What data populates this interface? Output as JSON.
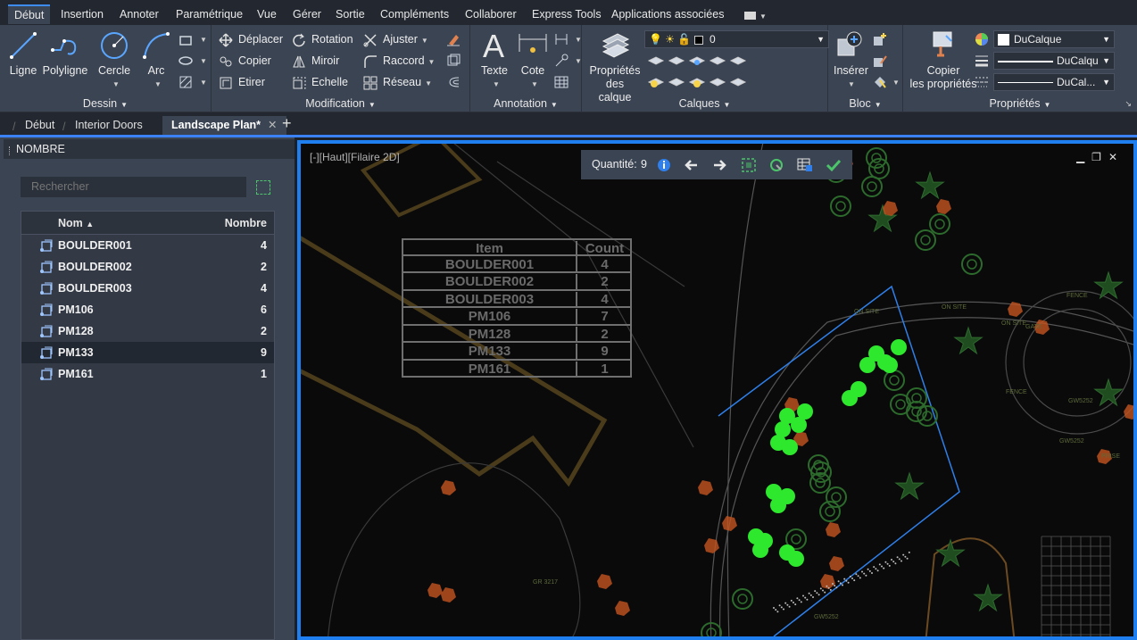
{
  "menu": {
    "tabs": [
      "Début",
      "Insertion",
      "Annoter",
      "Paramétrique",
      "Vue",
      "Gérer",
      "Sortie",
      "Compléments",
      "Collaborer",
      "Express Tools",
      "Applications associées"
    ],
    "active_tab": "Début"
  },
  "ribbon": {
    "dessin": {
      "title": "Dessin",
      "ligne": "Ligne",
      "polyligne": "Polyligne",
      "cercle": "Cercle",
      "arc": "Arc"
    },
    "modification": {
      "title": "Modification",
      "deplacer": "Déplacer",
      "rotation": "Rotation",
      "ajuster": "Ajuster",
      "copier": "Copier",
      "miroir": "Miroir",
      "raccord": "Raccord",
      "etirer": "Etirer",
      "echelle": "Echelle",
      "reseau": "Réseau"
    },
    "annotation": {
      "title": "Annotation",
      "texte": "Texte",
      "cote": "Cote"
    },
    "calques": {
      "title": "Calques",
      "proprietes_line1": "Propriétés",
      "proprietes_line2": "des calque",
      "current_layer": "0"
    },
    "bloc": {
      "title": "Bloc",
      "inserer": "Insérer"
    },
    "proprietes": {
      "title": "Propriétés",
      "copier_line1": "Copier",
      "copier_line2": "les propriétés",
      "color": "DuCalque",
      "linetype": "DuCalqu",
      "lineweight": "DuCal..."
    }
  },
  "doc_tabs": [
    "Début",
    "Interior Doors",
    "Landscape Plan*"
  ],
  "active_doc": "Landscape Plan*",
  "palette": {
    "title": "NOMBRE",
    "search_placeholder": "Rechercher",
    "col_name": "Nom",
    "col_count": "Nombre",
    "rows": [
      {
        "name": "BOULDER001",
        "count": "4"
      },
      {
        "name": "BOULDER002",
        "count": "2"
      },
      {
        "name": "BOULDER003",
        "count": "4"
      },
      {
        "name": "PM106",
        "count": "6"
      },
      {
        "name": "PM128",
        "count": "2"
      },
      {
        "name": "PM133",
        "count": "9"
      },
      {
        "name": "PM161",
        "count": "1"
      }
    ],
    "selected_row": "PM133"
  },
  "viewport": {
    "view_label": "[-][Haut][Filaire 2D]",
    "quantity_label": "Quantité:",
    "quantity_value": "9",
    "drawing_table": {
      "header_item": "Item",
      "header_count": "Count",
      "rows": [
        {
          "item": "BOULDER001",
          "count": "4"
        },
        {
          "item": "BOULDER002",
          "count": "2"
        },
        {
          "item": "BOULDER003",
          "count": "4"
        },
        {
          "item": "PM106",
          "count": "7"
        },
        {
          "item": "PM128",
          "count": "2"
        },
        {
          "item": "PM133",
          "count": "9"
        },
        {
          "item": "PM161",
          "count": "1"
        }
      ]
    },
    "labels": {
      "on_site_1": "ON SITE",
      "on_site_2": "ON SITE",
      "on_site_3": "ON SITE",
      "gr": "GR 3217",
      "gw1": "GW5252",
      "gw2": "GW5252",
      "gw3": "GW5252",
      "fence1": "FENCE",
      "fence2": "FENCE",
      "gate": "GATE",
      "prise": "PRISE"
    }
  },
  "colors": {
    "accent": "#1f7ff0",
    "ribbon_bg": "#3b4453",
    "highlight_green": "#2ee82e",
    "block_orange": "#c4541f",
    "drawing_green": "#2d6b2d"
  }
}
